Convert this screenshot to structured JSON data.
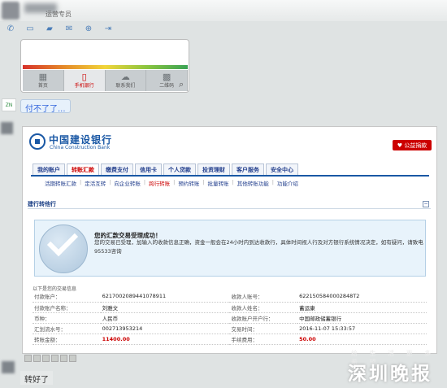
{
  "chat": {
    "contact_name": "运营专员",
    "message_1": "付不了了...",
    "message_2": "转好了"
  },
  "toolbar_icons": [
    "phone-icon",
    "screen-share-icon",
    "folder-icon",
    "mail-icon",
    "add-contact-icon",
    "exit-icon"
  ],
  "phone_nav": {
    "items": [
      {
        "label": "首页",
        "icon": "grid-icon"
      },
      {
        "label": "手机银行",
        "icon": "mobile-icon"
      },
      {
        "label": "联系我们",
        "icon": "chat-icon"
      },
      {
        "label": "二维码",
        "icon": "qrcode-icon"
      }
    ]
  },
  "bank": {
    "name_cn": "中国建设银行",
    "name_en": "China Construction Bank",
    "fav_label": "♥ 公益捐款",
    "tabs": [
      "我的账户",
      "转账汇款",
      "缴费支付",
      "信用卡",
      "个人贷款",
      "投资理财",
      "客户服务",
      "安全中心"
    ],
    "subtabs": [
      "活期转账汇款",
      "定活互转",
      "向企业转账",
      "跨行转账",
      "预约转账",
      "批量转账",
      "其他转账功能",
      "功能介绍"
    ],
    "section_title": "建行转他行",
    "success_title": "您的汇款交易受理成功！",
    "success_desc": "您的交易已受理，加输入的收款信息正确，资金一般会在24小时内到达收款行，具体时间视人行及对方银行系统情况决定，如有疑问，请致电95533咨询",
    "detail_title": "以下是您的交易信息",
    "details": [
      {
        "l1": "付款账户：",
        "v1": "6217002089441078911",
        "l2": "收款人账号：",
        "v2": "6221505840002848T2"
      },
      {
        "l1": "付款账户名称：",
        "v1": "刘雅文",
        "l2": "收款人姓名：",
        "v2": "蓄运康"
      },
      {
        "l1": "币种：",
        "v1": "人民币",
        "l2": "收款账户开户行：",
        "v2": "中国邮政储蓄银行"
      },
      {
        "l1": "汇划流水号：",
        "v1": "002713953214",
        "l2": "交易时间：",
        "v2": "2016-11-07 15:33:57"
      },
      {
        "l1": "转账金额：",
        "v1": "11400.00",
        "l2": "手续费用：",
        "v2": "50.00"
      }
    ]
  },
  "watermark": {
    "small": "给 生 活 更 多 希 望",
    "big": "深圳晚报"
  }
}
